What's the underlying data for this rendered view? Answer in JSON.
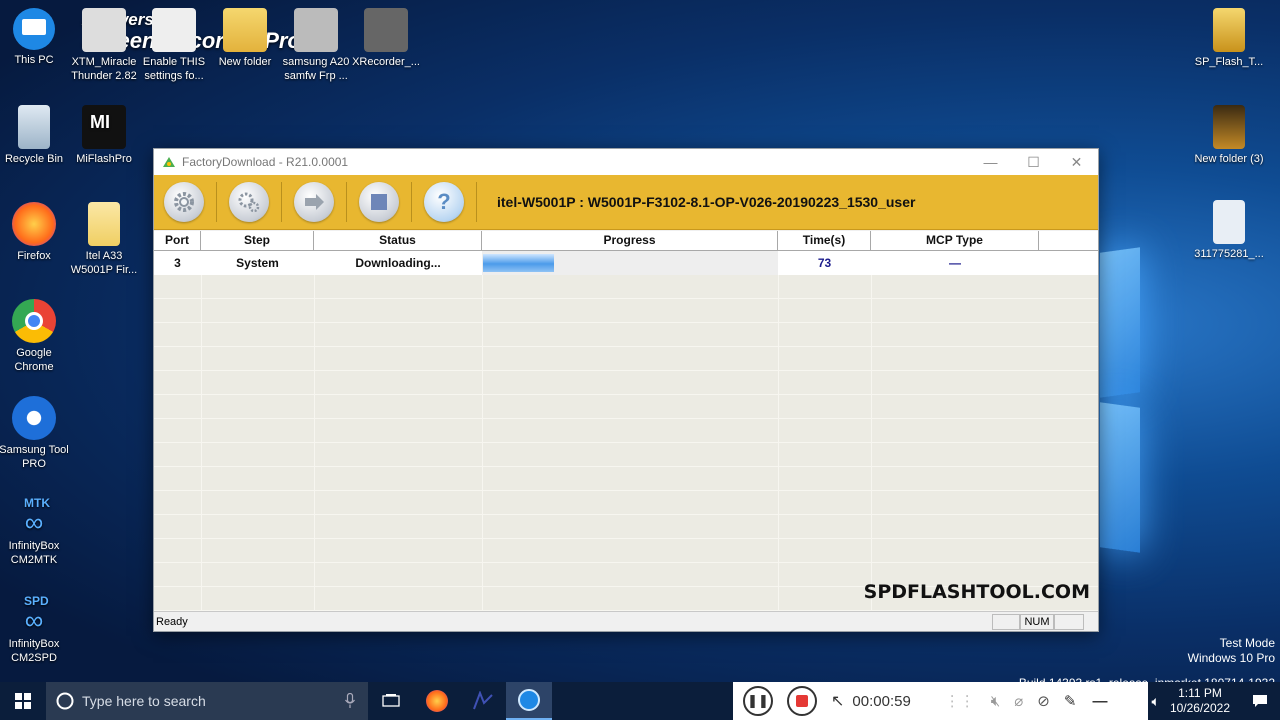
{
  "recorder": {
    "brand": "Apowersoft",
    "product": "Screen Recorder Pro"
  },
  "desktop": {
    "icons": [
      {
        "label": "This PC"
      },
      {
        "label": "XTM_Miracle Thunder 2.82"
      },
      {
        "label": "Enable THIS settings fo..."
      },
      {
        "label": "New folder"
      },
      {
        "label": "samsung A20 samfw Frp ..."
      },
      {
        "label": "XRecorder_..."
      },
      {
        "label": "Recycle Bin"
      },
      {
        "label": "MiFlashPro"
      },
      {
        "label": "Firefox"
      },
      {
        "label": "Itel A33 W5001P Fir..."
      },
      {
        "label": "Google Chrome"
      },
      {
        "label": "Samsung Tool PRO"
      },
      {
        "label": "InfinityBox CM2MTK",
        "tag": "MTK"
      },
      {
        "label": "InfinityBox CM2SPD",
        "tag": "SPD"
      },
      {
        "label": "SP_Flash_T..."
      },
      {
        "label": "New folder (3)"
      },
      {
        "label": "311775281_..."
      }
    ]
  },
  "window": {
    "title": "FactoryDownload - R21.0.0001",
    "device_info": "itel-W5001P : W5001P-F3102-8.1-OP-V026-20190223_1530_user",
    "toolbar": [
      {
        "name": "settings-button",
        "icon": "gear-icon"
      },
      {
        "name": "options-button",
        "icon": "gears-icon"
      },
      {
        "name": "start-button",
        "icon": "play-icon"
      },
      {
        "name": "stop-button",
        "icon": "stop-icon"
      },
      {
        "name": "help-button",
        "icon": "help-icon"
      }
    ],
    "grid": {
      "columns": [
        "Port",
        "Step",
        "Status",
        "Progress",
        "Time(s)",
        "MCP Type"
      ],
      "rows": [
        {
          "port": "3",
          "step": "System",
          "status": "Downloading...",
          "progress": 0.24,
          "time": "73",
          "mcp": "—"
        }
      ]
    },
    "watermark": "SPDFLASHTOOL.COM",
    "status": {
      "text": "Ready",
      "num": "NUM"
    }
  },
  "os": {
    "testmode_line1": "Test Mode",
    "testmode_line2": "Windows 10 Pro",
    "build": "Build 14393.rs1_release_inmarket.180714-1932"
  },
  "taskbar": {
    "search_placeholder": "Type here to search",
    "recording_time": "00:00:59",
    "time": "1:11 PM",
    "date": "10/26/2022"
  },
  "colors": {
    "toolbar": "#e8b730",
    "time_value": "#1c1c8c",
    "taskbar": "#0b1e3b"
  }
}
